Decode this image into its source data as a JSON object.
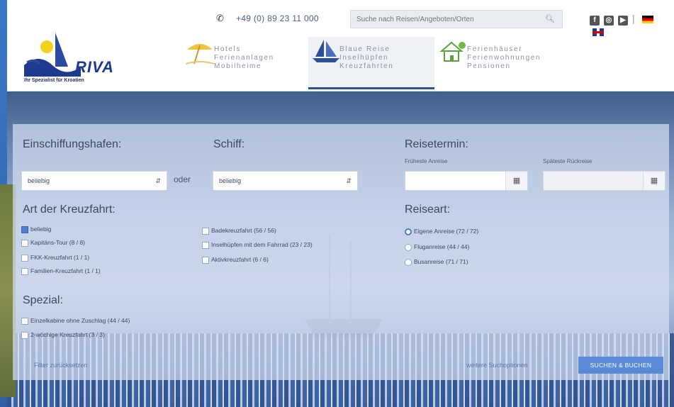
{
  "header": {
    "phone": "+49 (0) 89 23 11 000",
    "search_placeholder": "Suche nach Reisen/Angeboten/Orten",
    "logo_word": "RIVA",
    "logo_tagline": "Ihr Spezialist für Kroatien",
    "tabs": [
      {
        "icon": "beach-umbrella-icon",
        "lines": [
          "Hotels",
          "Ferienanlagen",
          "Mobilheime"
        ],
        "active": false
      },
      {
        "icon": "sailboat-icon",
        "lines": [
          "Blaue Reise",
          "Inselhüpfen",
          "Kreuzfahrten"
        ],
        "active": true
      },
      {
        "icon": "house-icon",
        "lines": [
          "Ferienhäuser",
          "Ferienwohnungen",
          "Pensionen"
        ],
        "active": false
      }
    ]
  },
  "panel": {
    "port_label": "Einschiffungshafen:",
    "port_value": "beliebig",
    "or_label": "oder",
    "ship_label": "Schiff:",
    "ship_value": "beliebig",
    "date_label": "Reisetermin:",
    "earliest_label": "Früheste Anreise",
    "latest_label": "Späteste Rückreise",
    "type_label": "Art der Kreuzfahrt:",
    "types_col1": [
      {
        "label": "beliebig",
        "checked": true
      },
      {
        "label": "Kapitäns-Tour (8 / 8)",
        "checked": false
      },
      {
        "label": "FKK-Kreuzfahrt (1 / 1)",
        "checked": false
      },
      {
        "label": "Familien-Kreuzfahrt (1 / 1)",
        "checked": false
      }
    ],
    "types_col2": [
      {
        "label": "Badekreuzfahrt (56 / 56)",
        "checked": false
      },
      {
        "label": "Inselhüpfen mit dem Fahrrad (23 / 23)",
        "checked": false
      },
      {
        "label": "Aktivkreuzfahrt (6 / 6)",
        "checked": false
      }
    ],
    "travel_label": "Reiseart:",
    "travel_options": [
      {
        "label": "Eigene Anreise (72 / 72)",
        "checked": true
      },
      {
        "label": "Fluganreise (44 / 44)",
        "checked": false
      },
      {
        "label": "Busanreise (71 / 71)",
        "checked": false
      }
    ],
    "special_label": "Spezial:",
    "special_options": [
      {
        "label": "Einzelkabine ohne Zuschlag (44 / 44)",
        "checked": false
      },
      {
        "label": "2-wöchige Kreuzfahrt (3 / 3)",
        "checked": false
      }
    ],
    "reset_label": "Filter zurücksetzen",
    "more_label": "weitere Suchoptionen",
    "submit_label": "SUCHEN & BUCHEN"
  },
  "colors": {
    "accent": "#5a8ad8",
    "brand": "#1d3a8f"
  }
}
